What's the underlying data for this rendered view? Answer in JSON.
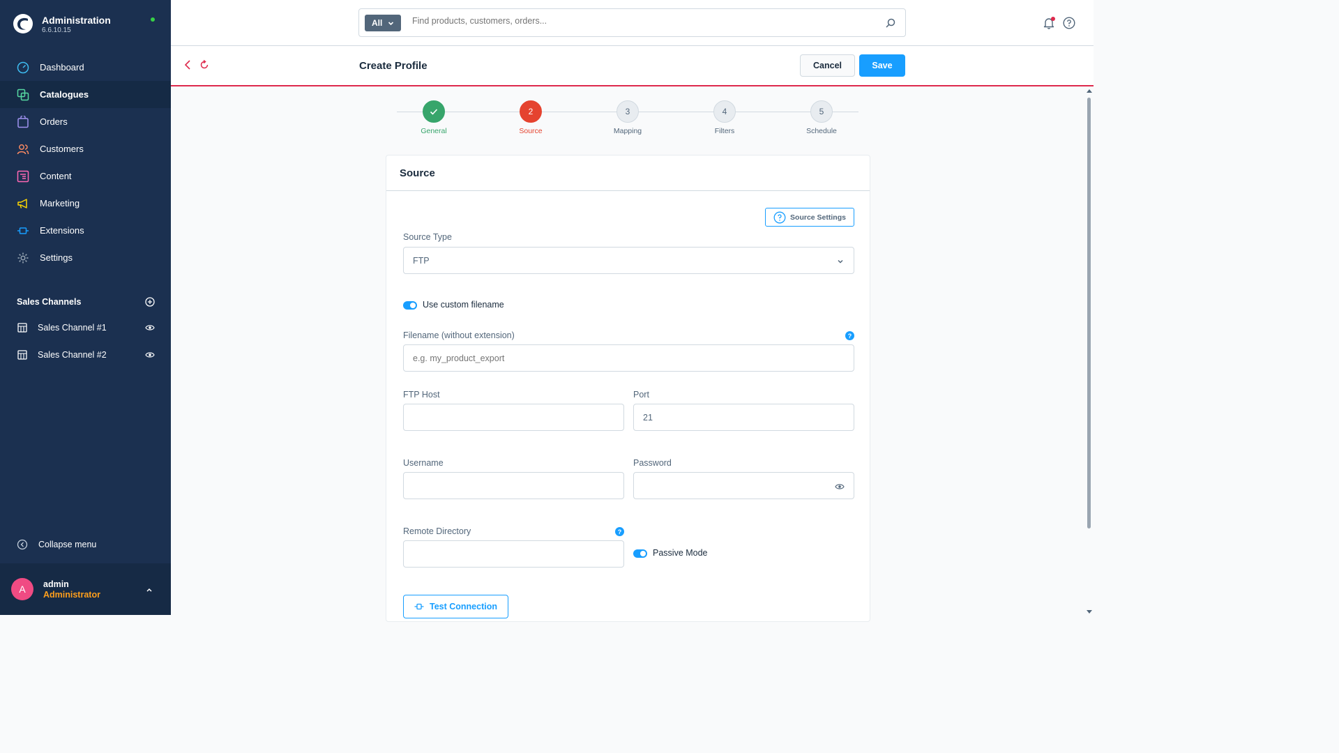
{
  "brand": {
    "title": "Administration",
    "version": "6.6.10.15"
  },
  "sidebar": {
    "items": [
      {
        "label": "Dashboard",
        "icon": "dashboard-icon",
        "color": "#3ebcf1"
      },
      {
        "label": "Catalogues",
        "icon": "catalogues-icon",
        "color": "#57d9a3"
      },
      {
        "label": "Orders",
        "icon": "orders-icon",
        "color": "#a092f0"
      },
      {
        "label": "Customers",
        "icon": "customers-icon",
        "color": "#f88962"
      },
      {
        "label": "Content",
        "icon": "content-icon",
        "color": "#ff68b4"
      },
      {
        "label": "Marketing",
        "icon": "marketing-icon",
        "color": "#ffd700"
      },
      {
        "label": "Extensions",
        "icon": "extensions-icon",
        "color": "#189eff"
      },
      {
        "label": "Settings",
        "icon": "settings-icon",
        "color": "#9aa8b5"
      }
    ],
    "active_index": 1,
    "sales_channels_title": "Sales Channels",
    "sales_channels": [
      {
        "label": "Sales Channel #1"
      },
      {
        "label": "Sales Channel #2"
      }
    ],
    "collapse_label": "Collapse menu"
  },
  "user": {
    "initial": "A",
    "name": "admin",
    "role": "Administrator"
  },
  "search": {
    "type_label": "All",
    "placeholder": "Find products, customers, orders..."
  },
  "smartbar": {
    "title": "Create Profile",
    "cancel_label": "Cancel",
    "save_label": "Save"
  },
  "stepper": {
    "steps": [
      {
        "number": "1",
        "label": "General",
        "state": "done"
      },
      {
        "number": "2",
        "label": "Source",
        "state": "current"
      },
      {
        "number": "3",
        "label": "Mapping",
        "state": "pending"
      },
      {
        "number": "4",
        "label": "Filters",
        "state": "pending"
      },
      {
        "number": "5",
        "label": "Schedule",
        "state": "pending"
      }
    ]
  },
  "card": {
    "title": "Source",
    "source_settings_label": "Source Settings",
    "source_type_label": "Source Type",
    "source_type_value": "FTP",
    "use_custom_filename_label": "Use custom filename",
    "use_custom_filename_on": true,
    "filename_label": "Filename (without extension)",
    "filename_placeholder": "e.g. my_product_export",
    "ftp_host_label": "FTP Host",
    "ftp_host_value": "",
    "port_label": "Port",
    "port_value": "21",
    "username_label": "Username",
    "username_value": "",
    "password_label": "Password",
    "password_value": "",
    "remote_directory_label": "Remote Directory",
    "remote_directory_value": "",
    "passive_mode_label": "Passive Mode",
    "passive_mode_on": true,
    "test_connection_label": "Test Connection",
    "help_glyph": "?"
  },
  "colors": {
    "sidebar_bg": "#1b3050",
    "accent": "#189eff",
    "danger": "#de294c",
    "success": "#37a56b",
    "current_step": "#e5432f",
    "role": "#ff9f1c"
  }
}
